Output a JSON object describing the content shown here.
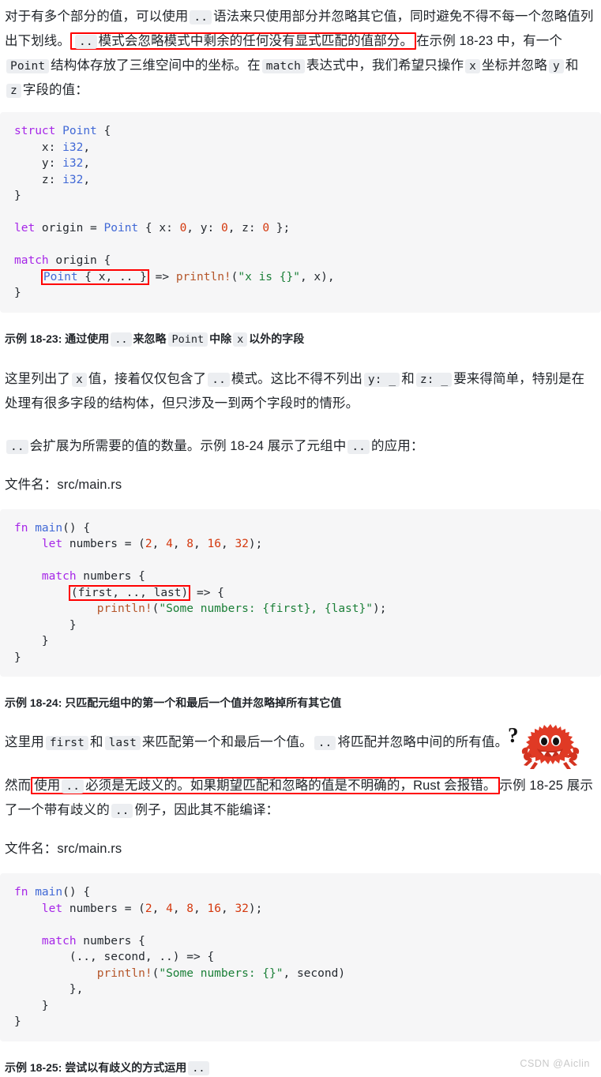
{
  "document": {
    "watermark": "CSDN @Aiclin"
  },
  "paragraphs": {
    "p1": {
      "seg1": "对于有多个部分的值，可以使用",
      "code1": "..",
      "seg2": "语法来只使用部分并忽略其它值，同时避免不得不每一个忽略值列出下划线。",
      "boxed_code": "..",
      "boxed_text": "模式会忽略模式中剩余的任何没有显式匹配的值部分。",
      "seg3": "在示例 18-23 中，有一个",
      "code2": "Point",
      "seg4": "结构体存放了三维空间中的坐标。在",
      "code3": "match",
      "seg5": "表达式中，我们希望只操作",
      "code4": "x",
      "seg6": "坐标并忽略",
      "code5": "y",
      "seg7": "和",
      "code6": "z",
      "seg8": "字段的值："
    },
    "p2": {
      "seg1": "这里列出了",
      "code1": "x",
      "seg2": "值，接着仅仅包含了",
      "code2": "..",
      "seg3": "模式。这比不得不列出",
      "code3": "y: _",
      "seg4": "和",
      "code4": "z: _",
      "seg5": "要来得简单，特别是在处理有很多字段的结构体，但只涉及一到两个字段时的情形。"
    },
    "p3": {
      "code1": "..",
      "seg1": "会扩展为所需要的值的数量。示例 18-24 展示了元组中",
      "code2": "..",
      "seg2": "的应用："
    },
    "p4": {
      "seg1": "这里用",
      "code1": "first",
      "seg2": "和",
      "code2": "last",
      "seg3": "来匹配第一个和最后一个值。",
      "code3": "..",
      "seg4": "将匹配并忽略中间的所有值。"
    },
    "p5": {
      "seg1": "然而",
      "boxed_seg1": "使用",
      "boxed_code": "..",
      "boxed_seg2": "必须是无歧义的。如果期望匹配和忽略的值是不明确的，Rust 会报错。",
      "seg2": "示例 18-25 展示了一个带有歧义的",
      "code1": "..",
      "seg3": "例子，因此其不能编译："
    },
    "filename1": "文件名：src/main.rs",
    "filename2": "文件名：src/main.rs"
  },
  "captions": {
    "c1": {
      "prefix": "示例 18-23: 通过使用",
      "code1": "..",
      "mid": "来忽略",
      "code2": "Point",
      "mid2": "中除",
      "code3": "x",
      "suffix": "以外的字段"
    },
    "c2": {
      "text": "示例 18-24: 只匹配元组中的第一个和最后一个值并忽略掉所有其它值"
    },
    "c3": {
      "prefix": "示例 18-25: 尝试以有歧义的方式运用",
      "code1": ".."
    }
  },
  "code_blocks": {
    "block1": {
      "lines": [
        "struct Point {",
        "    x: i32,",
        "    y: i32,",
        "    z: i32,",
        "}",
        "",
        "let origin = Point { x: 0, y: 0, z: 0 };",
        "",
        "match origin {",
        "    Point { x, .. } => println!(\"x is {}\", x),",
        "}"
      ],
      "highlighted_fragment": "Point { x, .. }"
    },
    "block2": {
      "lines": [
        "fn main() {",
        "    let numbers = (2, 4, 8, 16, 32);",
        "",
        "    match numbers {",
        "        (first, .., last) => {",
        "            println!(\"Some numbers: {first}, {last}\");",
        "        }",
        "    }",
        "}"
      ],
      "highlighted_fragment": "(first, .., last)"
    },
    "block3": {
      "lines": [
        "fn main() {",
        "    let numbers = (2, 4, 8, 16, 32);",
        "",
        "    match numbers {",
        "        (.., second, ..) => {",
        "            println!(\"Some numbers: {}\", second)",
        "        },",
        "    }",
        "}"
      ],
      "highlighted_fragment": ""
    }
  },
  "mascot": {
    "name": "ferris-crab",
    "question_mark": "?",
    "body_color": "#e03a25",
    "claw_color": "#d4321f"
  },
  "colors": {
    "annotation_red": "#ff0000",
    "code_bg": "#f6f6f7",
    "inline_code_bg": "#eceef1",
    "text": "#1f2328",
    "keyword_purple": "#a626e8",
    "type_blue": "#4169d6",
    "number_red": "#d4380d",
    "macro_brown": "#b5562a",
    "string_green": "#1a7f37"
  }
}
